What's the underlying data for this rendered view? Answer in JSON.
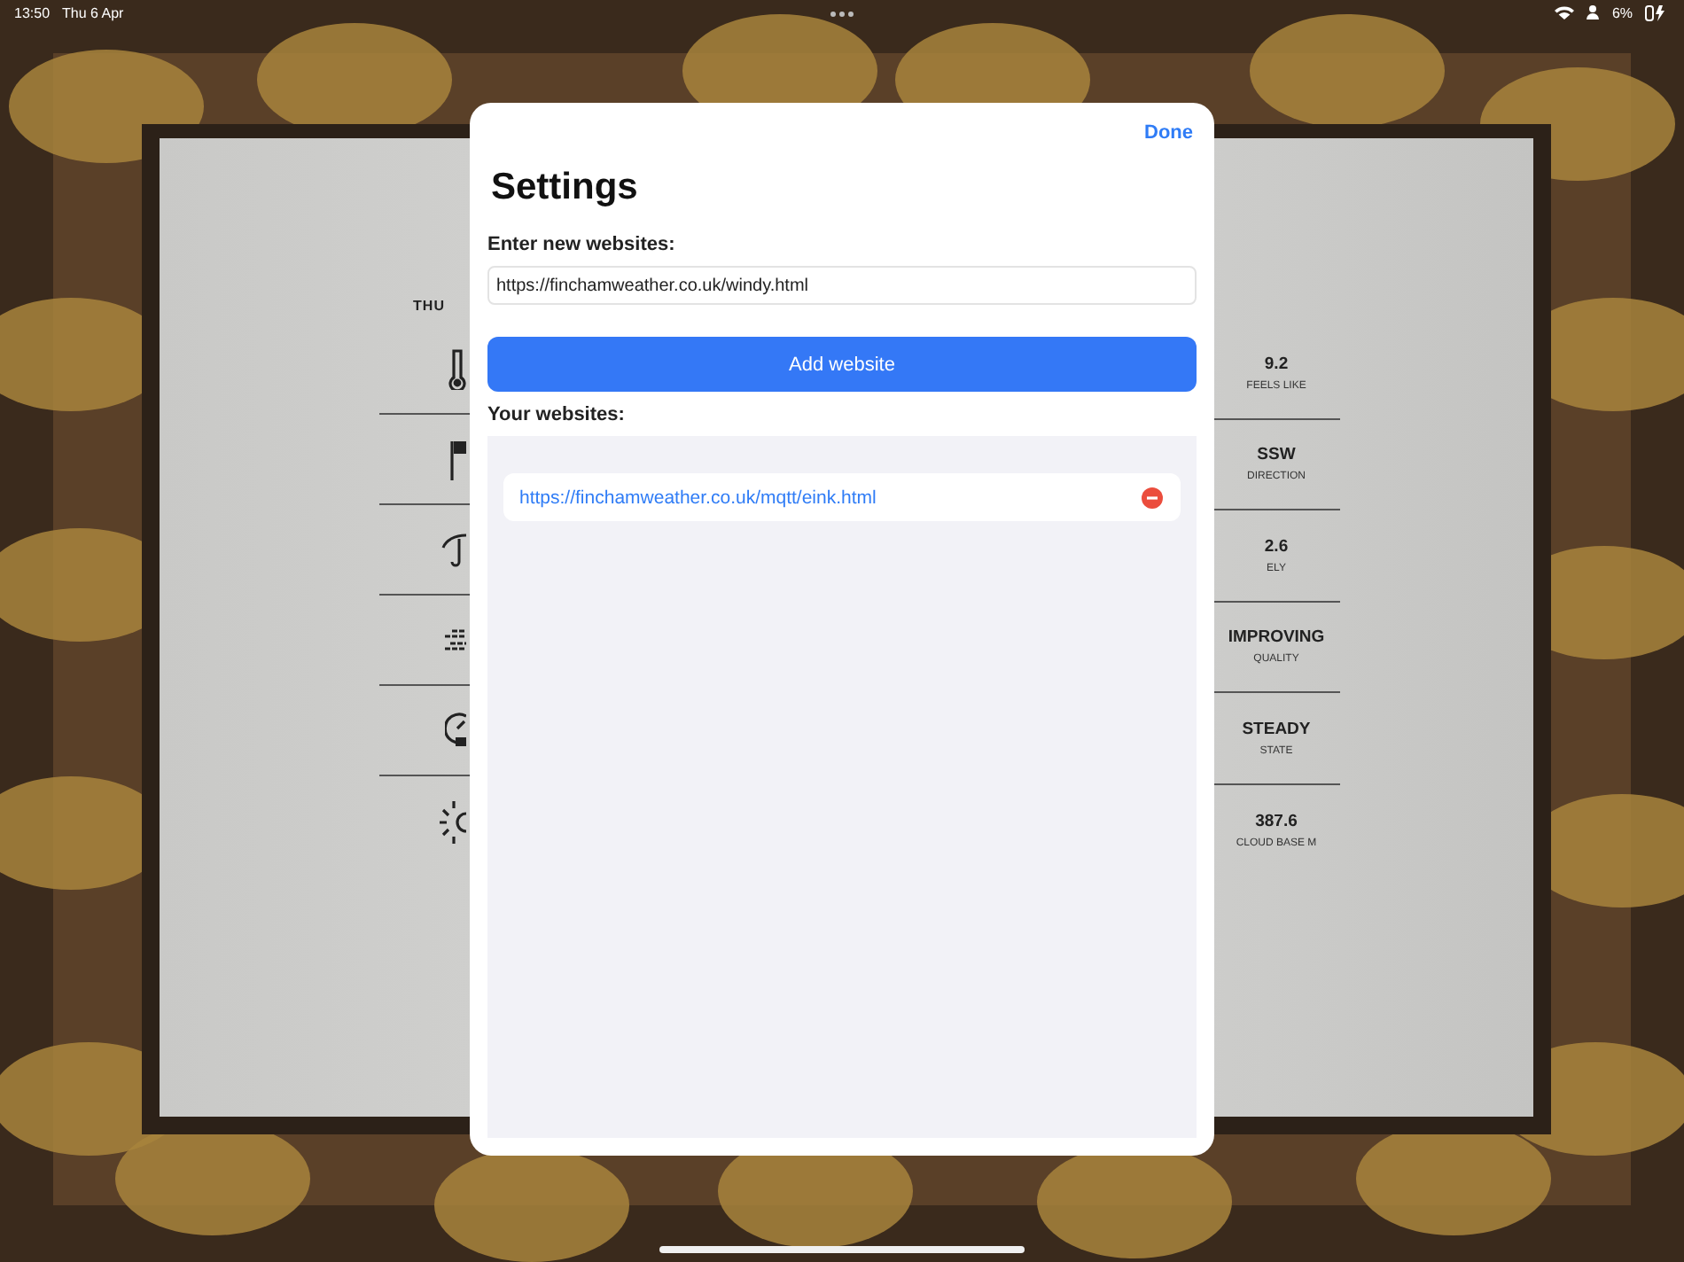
{
  "status_bar": {
    "time": "13:50",
    "date": "Thu 6 Apr",
    "battery": "6%"
  },
  "weather_page": {
    "day": "THU",
    "readings": [
      {
        "value": "9.2",
        "label": "FEELS LIKE"
      },
      {
        "value": "SSW",
        "label": "DIRECTION"
      },
      {
        "value": "2.6",
        "label": "ELY"
      },
      {
        "value": "IMPROVING",
        "label": "QUALITY"
      },
      {
        "value": "STEADY",
        "label": "STATE"
      },
      {
        "value": "387.6",
        "label": "CLOUD BASE M"
      }
    ]
  },
  "settings": {
    "done": "Done",
    "title": "Settings",
    "new_label": "Enter new websites:",
    "input_value": "https://finchamweather.co.uk/windy.html",
    "add_button": "Add website",
    "list_label": "Your websites:",
    "websites": [
      "https://finchamweather.co.uk/mqtt/eink.html"
    ]
  }
}
